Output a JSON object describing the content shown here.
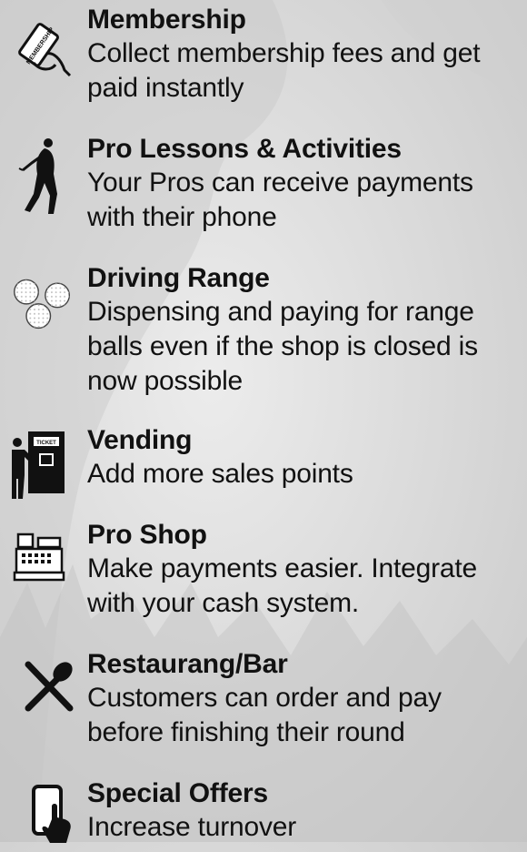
{
  "features": [
    {
      "title": "Membership",
      "description": "Collect membership fees and get paid instantly",
      "icon": "membership-card-icon"
    },
    {
      "title": "Pro Lessons & Activities",
      "description": "Your Pros can receive payments with their phone",
      "icon": "golfer-icon"
    },
    {
      "title": "Driving Range",
      "description": "Dispensing and paying for range balls even if the shop is closed is now possible",
      "icon": "golf-balls-icon"
    },
    {
      "title": "Vending",
      "description": "Add more sales points",
      "icon": "ticket-machine-icon"
    },
    {
      "title": "Pro Shop",
      "description": "Make payments easier. Integrate with your cash system.",
      "icon": "cash-register-icon"
    },
    {
      "title": "Restaurang/Bar",
      "description": "Customers can order and pay before finishing their round",
      "icon": "utensils-icon"
    },
    {
      "title": "Special Offers",
      "description": "Increase turnover",
      "icon": "phone-tap-icon"
    }
  ],
  "card_text": "MEMBERSHIP",
  "ticket_text": "TICKET"
}
